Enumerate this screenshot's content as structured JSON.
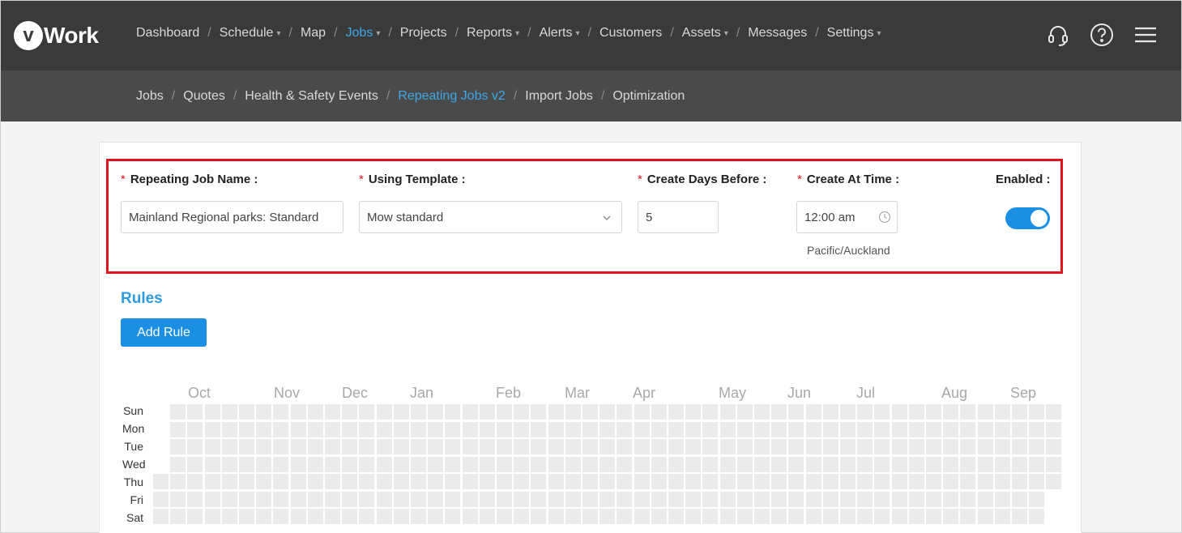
{
  "logo": {
    "mark": "v",
    "text": "Work"
  },
  "main_nav": [
    {
      "label": "Dashboard",
      "dropdown": false,
      "active": false
    },
    {
      "label": "Schedule",
      "dropdown": true,
      "active": false
    },
    {
      "label": "Map",
      "dropdown": false,
      "active": false
    },
    {
      "label": "Jobs",
      "dropdown": true,
      "active": true
    },
    {
      "label": "Projects",
      "dropdown": false,
      "active": false
    },
    {
      "label": "Reports",
      "dropdown": true,
      "active": false
    },
    {
      "label": "Alerts",
      "dropdown": true,
      "active": false
    },
    {
      "label": "Customers",
      "dropdown": false,
      "active": false
    },
    {
      "label": "Assets",
      "dropdown": true,
      "active": false
    },
    {
      "label": "Messages",
      "dropdown": false,
      "active": false
    },
    {
      "label": "Settings",
      "dropdown": true,
      "active": false
    }
  ],
  "top_icons": [
    "headset-icon",
    "help-icon",
    "menu-icon"
  ],
  "sub_nav": [
    {
      "label": "Jobs",
      "active": false
    },
    {
      "label": "Quotes",
      "active": false
    },
    {
      "label": "Health & Safety Events",
      "active": false
    },
    {
      "label": "Repeating Jobs v2",
      "active": true
    },
    {
      "label": "Import Jobs",
      "active": false
    },
    {
      "label": "Optimization",
      "active": false
    }
  ],
  "form": {
    "name_label": "Repeating Job Name",
    "name_value": "Mainland Regional parks: Standard",
    "template_label": "Using Template",
    "template_value": "Mow standard",
    "days_label": "Create Days Before",
    "days_value": "5",
    "time_label": "Create At Time",
    "time_value": "12:00 am",
    "timezone": "Pacific/Auckland",
    "enabled_label": "Enabled",
    "enabled": true,
    "required_mark": "*",
    "colon": ":"
  },
  "rules": {
    "title": "Rules",
    "add_button": "Add Rule",
    "months": [
      "Oct",
      "Nov",
      "Dec",
      "Jan",
      "Feb",
      "Mar",
      "Apr",
      "May",
      "Jun",
      "Jul",
      "Aug",
      "Sep"
    ],
    "days": [
      "Sun",
      "Mon",
      "Tue",
      "Wed",
      "Thu",
      "Fri",
      "Sat"
    ]
  },
  "colors": {
    "accent": "#1a8fe3",
    "active_link": "#3ea8e8",
    "highlight_border": "#e0141e",
    "cell_empty": "#ebebeb"
  }
}
